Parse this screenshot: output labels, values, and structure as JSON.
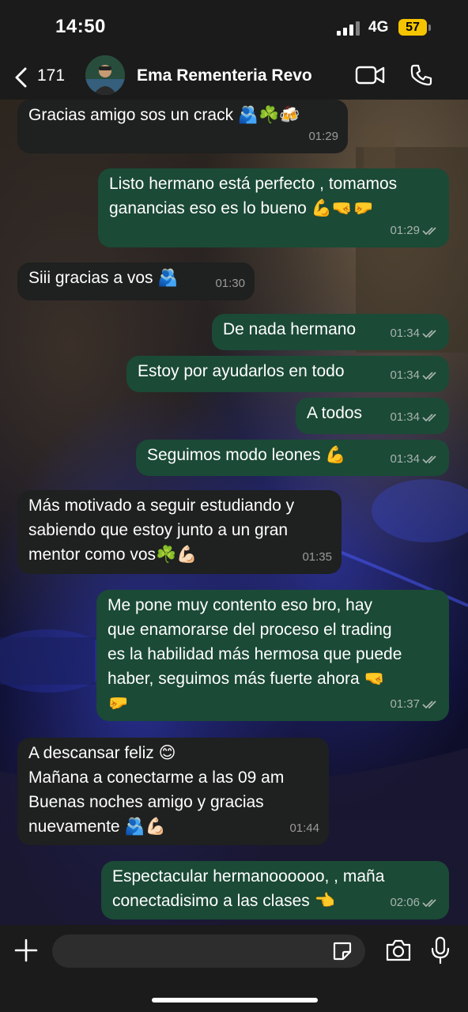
{
  "status": {
    "time": "14:50",
    "network": "4G",
    "battery": "57"
  },
  "header": {
    "back_count": "171",
    "contact_name": "Ema Rementeria Revo"
  },
  "messages": [
    {
      "dir": "in",
      "lines": [
        "Gracias amigo sos un crack 🫂☘️🍻"
      ],
      "time": "01:29"
    },
    {
      "dir": "out",
      "lines": [
        "Listo hermano está perfecto , tomamos",
        "ganancias eso es lo bueno 💪🤜🤛"
      ],
      "time": "01:29"
    },
    {
      "dir": "in",
      "lines": [
        "Siii gracias a vos 🫂"
      ],
      "time": "01:30"
    },
    {
      "dir": "out",
      "lines": [
        "De nada hermano"
      ],
      "time": "01:34"
    },
    {
      "dir": "out",
      "lines": [
        "Estoy por ayudarlos en todo"
      ],
      "time": "01:34"
    },
    {
      "dir": "out",
      "lines": [
        "A todos"
      ],
      "time": "01:34"
    },
    {
      "dir": "out",
      "lines": [
        "Seguimos modo leones 💪"
      ],
      "time": "01:34"
    },
    {
      "dir": "in",
      "lines": [
        "Más motivado a seguir estudiando y",
        "sabiendo que estoy junto a un gran",
        "mentor como vos☘️💪🏻"
      ],
      "time": "01:35"
    },
    {
      "dir": "out",
      "lines": [
        "Me pone muy contento eso bro, hay",
        "que enamorarse del proceso el trading",
        "es la habilidad más hermosa que puede",
        "haber, seguimos más fuerte ahora 🤜",
        "🤛"
      ],
      "time": "01:37"
    },
    {
      "dir": "in",
      "lines": [
        "A descansar feliz 😊",
        "Mañana a conectarme a las 09 am",
        "Buenas noches amigo y gracias",
        "nuevamente 🫂💪🏻"
      ],
      "time": "01:44"
    },
    {
      "dir": "out",
      "lines": [
        "Espectacular hermanoooooo, , maña",
        "conectadisimo a las clases 👈"
      ],
      "time": "02:06"
    }
  ],
  "input": {
    "placeholder": ""
  },
  "icons": {
    "back": "chevron-left-icon",
    "video": "video-camera-icon",
    "phone": "phone-icon",
    "plus": "plus-icon",
    "sticker": "sticker-icon",
    "camera": "camera-icon",
    "mic": "microphone-icon",
    "scroll": "chevron-down-icon"
  },
  "colors": {
    "incoming_bubble": "#1f2020",
    "outgoing_bubble": "#1b4a36",
    "battery": "#f5c400"
  }
}
